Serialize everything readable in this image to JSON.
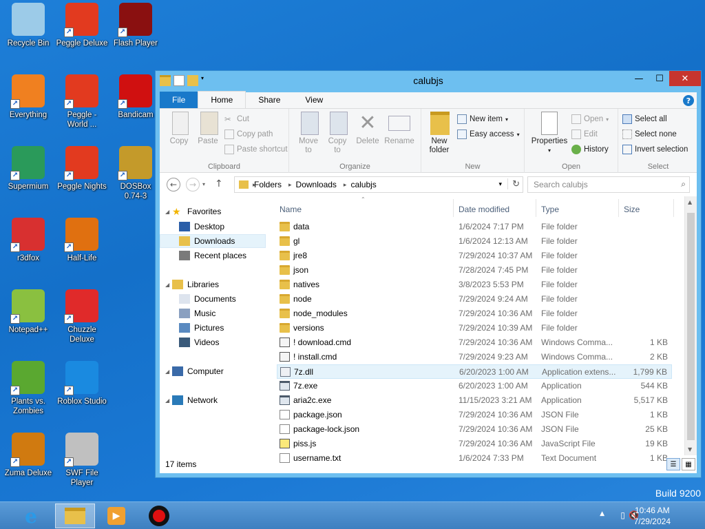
{
  "desktop": {
    "icons": [
      {
        "label": "Recycle Bin",
        "icon": "recycle-bin-icon",
        "color": "#9ccbe8"
      },
      {
        "label": "Peggle Deluxe",
        "icon": "peggle-icon",
        "color": "#e23a1f"
      },
      {
        "label": "Flash Player",
        "icon": "flash-icon",
        "color": "#8a1010"
      },
      {
        "label": "Everything",
        "icon": "everything-icon",
        "color": "#f08020"
      },
      {
        "label": "Peggle -\nWorld ...",
        "icon": "peggle-icon",
        "color": "#e23a1f"
      },
      {
        "label": "Bandicam",
        "icon": "bandicam-icon",
        "color": "#d01010"
      },
      {
        "label": "Supermium",
        "icon": "supermium-icon",
        "color": "#2a9a5a"
      },
      {
        "label": "Peggle Nights",
        "icon": "peggle-icon",
        "color": "#e23a1f"
      },
      {
        "label": "DOSBox\n0.74-3",
        "icon": "dosbox-icon",
        "color": "#c49a2a"
      },
      {
        "label": "r3dfox",
        "icon": "r3dfox-icon",
        "color": "#d83030"
      },
      {
        "label": "Half-Life",
        "icon": "halflife-icon",
        "color": "#e07010"
      },
      {
        "label": "Notepad++",
        "icon": "notepadpp-icon",
        "color": "#8ac040"
      },
      {
        "label": "Chuzzle\nDeluxe",
        "icon": "chuzzle-icon",
        "color": "#e02a2a"
      },
      {
        "label": "Plants vs.\nZombies",
        "icon": "pvz-icon",
        "color": "#5aa830"
      },
      {
        "label": "Roblox Studio",
        "icon": "roblox-studio-icon",
        "color": "#1a8ae0"
      },
      {
        "label": "Zuma Deluxe",
        "icon": "zuma-icon",
        "color": "#d07a10"
      },
      {
        "label": "SWF File\nPlayer",
        "icon": "swf-player-icon",
        "color": "#c0c0c0"
      }
    ],
    "build": "Build 9200"
  },
  "window": {
    "title": "calubjs",
    "tabs": [
      "File",
      "Home",
      "Share",
      "View"
    ],
    "ribbon": {
      "clipboard": {
        "name": "Clipboard",
        "copy": "Copy",
        "paste": "Paste",
        "cut": "Cut",
        "copy_path": "Copy path",
        "paste_shortcut": "Paste shortcut"
      },
      "organize": {
        "name": "Organize",
        "move_to": "Move\nto",
        "copy_to": "Copy\nto",
        "delete": "Delete",
        "rename": "Rename"
      },
      "new": {
        "name": "New",
        "new_folder": "New\nfolder",
        "new_item": "New item",
        "easy_access": "Easy access"
      },
      "open": {
        "name": "Open",
        "properties": "Properties",
        "open": "Open",
        "edit": "Edit",
        "history": "History"
      },
      "select": {
        "name": "Select",
        "select_all": "Select all",
        "select_none": "Select none",
        "invert": "Invert selection"
      }
    },
    "address": {
      "crumbs": [
        "Folders",
        "Downloads",
        "calubjs"
      ],
      "search_placeholder": "Search calubjs"
    },
    "nav": [
      {
        "label": "Favorites",
        "icon": "star-icon"
      },
      {
        "label": "Desktop",
        "icon": "desktop-icon"
      },
      {
        "label": "Downloads",
        "icon": "downloads-icon"
      },
      {
        "label": "Recent places",
        "icon": "recent-places-icon"
      },
      {
        "label": "Libraries",
        "icon": "libraries-icon"
      },
      {
        "label": "Documents",
        "icon": "documents-icon"
      },
      {
        "label": "Music",
        "icon": "music-icon"
      },
      {
        "label": "Pictures",
        "icon": "pictures-icon"
      },
      {
        "label": "Videos",
        "icon": "videos-icon"
      },
      {
        "label": "Computer",
        "icon": "computer-icon"
      },
      {
        "label": "Network",
        "icon": "network-icon"
      }
    ],
    "columns": {
      "name": "Name",
      "date": "Date modified",
      "type": "Type",
      "size": "Size"
    },
    "files": [
      {
        "name": "data",
        "date": "1/6/2024 7:17 PM",
        "type": "File folder",
        "size": "",
        "kind": "folder"
      },
      {
        "name": "gl",
        "date": "1/6/2024 12:13 AM",
        "type": "File folder",
        "size": "",
        "kind": "folder"
      },
      {
        "name": "jre8",
        "date": "7/29/2024 10:37 AM",
        "type": "File folder",
        "size": "",
        "kind": "folder"
      },
      {
        "name": "json",
        "date": "7/28/2024 7:45 PM",
        "type": "File folder",
        "size": "",
        "kind": "folder"
      },
      {
        "name": "natives",
        "date": "3/8/2023 5:53 PM",
        "type": "File folder",
        "size": "",
        "kind": "folder"
      },
      {
        "name": "node",
        "date": "7/29/2024 9:24 AM",
        "type": "File folder",
        "size": "",
        "kind": "folder"
      },
      {
        "name": "node_modules",
        "date": "7/29/2024 10:36 AM",
        "type": "File folder",
        "size": "",
        "kind": "folder"
      },
      {
        "name": "versions",
        "date": "7/29/2024 10:39 AM",
        "type": "File folder",
        "size": "",
        "kind": "folder"
      },
      {
        "name": "! download.cmd",
        "date": "7/29/2024 10:36 AM",
        "type": "Windows Comma...",
        "size": "1 KB",
        "kind": "cmd"
      },
      {
        "name": "! install.cmd",
        "date": "7/29/2024 9:23 AM",
        "type": "Windows Comma...",
        "size": "2 KB",
        "kind": "cmd"
      },
      {
        "name": "7z.dll",
        "date": "6/20/2023 1:00 AM",
        "type": "Application extens...",
        "size": "1,799 KB",
        "kind": "dll"
      },
      {
        "name": "7z.exe",
        "date": "6/20/2023 1:00 AM",
        "type": "Application",
        "size": "544 KB",
        "kind": "exe"
      },
      {
        "name": "aria2c.exe",
        "date": "11/15/2023 3:21 AM",
        "type": "Application",
        "size": "5,517 KB",
        "kind": "exe"
      },
      {
        "name": "package.json",
        "date": "7/29/2024 10:36 AM",
        "type": "JSON File",
        "size": "1 KB",
        "kind": "doc"
      },
      {
        "name": "package-lock.json",
        "date": "7/29/2024 10:36 AM",
        "type": "JSON File",
        "size": "25 KB",
        "kind": "doc"
      },
      {
        "name": "piss.js",
        "date": "7/29/2024 10:36 AM",
        "type": "JavaScript File",
        "size": "19 KB",
        "kind": "js"
      },
      {
        "name": "username.txt",
        "date": "1/6/2024 7:33 PM",
        "type": "Text Document",
        "size": "1 KB",
        "kind": "doc"
      }
    ],
    "hover_row": 10,
    "status": "17 items"
  },
  "taskbar": {
    "apps": [
      "ie-icon",
      "file-explorer-icon",
      "media-player-icon",
      "bandicam-record-icon"
    ],
    "time": "10:46 AM",
    "date": "7/29/2024"
  }
}
